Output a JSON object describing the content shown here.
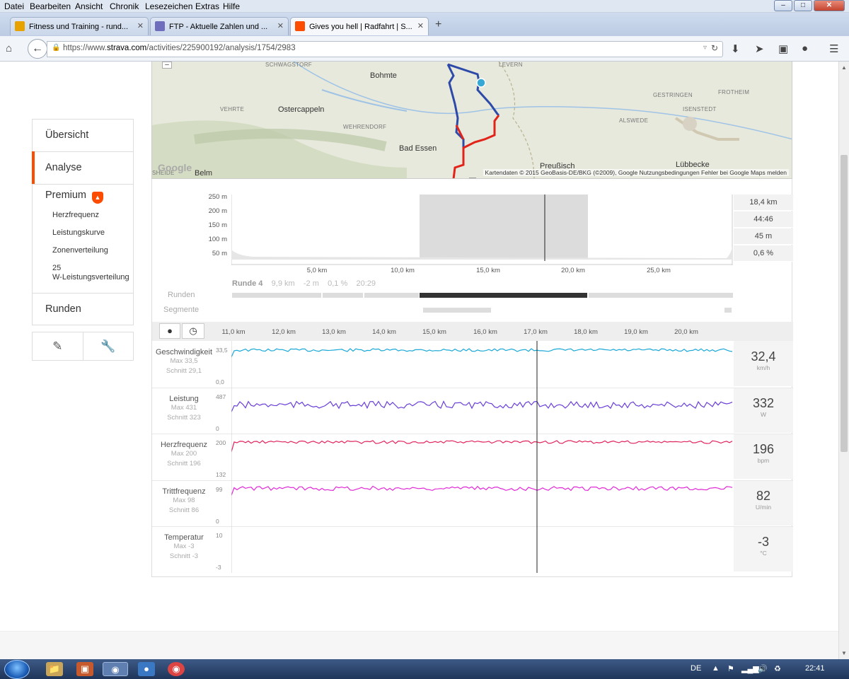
{
  "menubar": [
    "Datei",
    "Bearbeiten",
    "Ansicht",
    "Chronik",
    "Lesezeichen",
    "Extras",
    "Hilfe"
  ],
  "tabs": [
    {
      "title": "Fitness und Training - rund...",
      "favicon_color": "#e8a200"
    },
    {
      "title": "FTP - Aktuelle Zahlen und ...",
      "favicon_color": "#6e6ebd"
    },
    {
      "title": "Gives you hell | Radfahrt | S...",
      "favicon_color": "#fc4c02",
      "active": true
    }
  ],
  "url": {
    "prefix": "https://www.",
    "domain": "strava.com",
    "path": "/activities/225900192/analysis/1754/2983"
  },
  "sidebar": {
    "items": [
      "Übersicht",
      "Analyse",
      "Premium",
      "Runden"
    ],
    "premium_subitems": [
      "Herzfrequenz",
      "Leistungskurve",
      "Zonenverteilung",
      "25",
      "W-Leistungsverteilung"
    ],
    "accent": "#fc4c02"
  },
  "map": {
    "labels": [
      "Bohmte",
      "Ostercappeln",
      "Bad Essen",
      "Belm",
      "Lübbecke",
      "Preußisch"
    ],
    "small_labels": [
      "SCHWAGSTORF",
      "VEHRTE",
      "WEHRENDORF",
      "GESTRINGEN",
      "FROTHEIM",
      "ISENSTEDT",
      "ALSWEDE",
      "LEVERN",
      "SHEIDE"
    ],
    "google": "Google",
    "attribution": "Kartendaten © 2015 GeoBasis-DE/BKG (©2009), Google   Nutzungsbedingungen   Fehler bei Google Maps melden"
  },
  "elevation": {
    "ylabels": [
      "250 m",
      "200 m",
      "150 m",
      "100 m",
      "50 m"
    ],
    "xlabels": [
      "5,0 km",
      "10,0 km",
      "15,0 km",
      "20,0 km",
      "25,0 km"
    ],
    "stats": [
      "18,4 km",
      "44:46",
      "45 m",
      "0,6 %"
    ]
  },
  "lap": {
    "name": "Runde 4",
    "distance": "9,9 km",
    "elev": "-2 m",
    "grade": "0,1 %",
    "time": "20:29"
  },
  "row_labels": {
    "runden": "Runden",
    "segmente": "Segmente"
  },
  "detail_km": [
    "11,0 km",
    "12,0 km",
    "13,0 km",
    "14,0 km",
    "15,0 km",
    "16,0 km",
    "17,0 km",
    "18,0 km",
    "19,0 km",
    "20,0 km"
  ],
  "streams": [
    {
      "name": "Geschwindigkeit",
      "max": "Max 33,5",
      "avg": "Schnitt 29,1",
      "top": "33,5",
      "bottom": "0,0",
      "value": "32,4",
      "unit": "km/h",
      "color": "#1aa8d6"
    },
    {
      "name": "Leistung",
      "max": "Max 431",
      "avg": "Schnitt 323",
      "top": "487",
      "bottom": "0",
      "value": "332",
      "unit": "W",
      "color": "#6a3fd6"
    },
    {
      "name": "Herzfrequenz",
      "max": "Max 200",
      "avg": "Schnitt 196",
      "top": "200",
      "bottom": "132",
      "value": "196",
      "unit": "bpm",
      "color": "#e0245e"
    },
    {
      "name": "Trittfrequenz",
      "max": "Max 98",
      "avg": "Schnitt 86",
      "top": "99",
      "bottom": "0",
      "value": "82",
      "unit": "U/min",
      "color": "#e02ad6"
    },
    {
      "name": "Temperatur",
      "max": "Max -3",
      "avg": "Schnitt -3",
      "top": "10",
      "bottom": "-3",
      "value": "-3",
      "unit": "°C",
      "color": "#999999"
    }
  ],
  "taskbar": {
    "lang": "DE",
    "time": "22:41"
  }
}
